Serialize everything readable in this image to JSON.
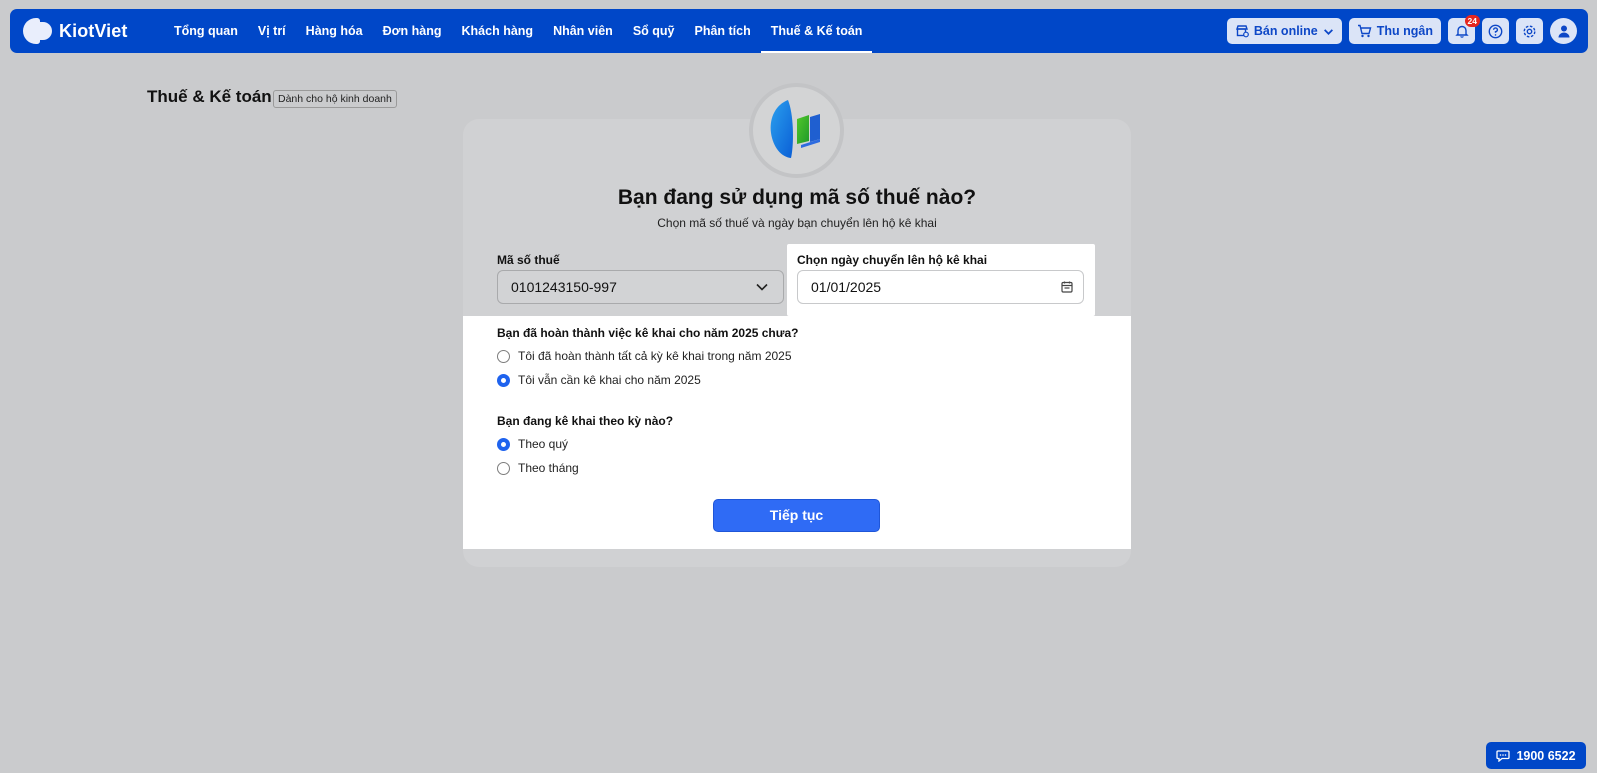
{
  "app": {
    "brand": "KiotViet"
  },
  "nav": {
    "items": [
      {
        "label": "Tổng quan"
      },
      {
        "label": "Vị trí"
      },
      {
        "label": "Hàng hóa"
      },
      {
        "label": "Đơn hàng"
      },
      {
        "label": "Khách hàng"
      },
      {
        "label": "Nhân viên"
      },
      {
        "label": "Sổ quỹ"
      },
      {
        "label": "Phân tích"
      },
      {
        "label": "Thuế & Kế toán"
      }
    ],
    "active": "Thuế & Kế toán",
    "sell_online_label": "Bán online",
    "cashier_label": "Thu ngân",
    "notification_count": "24"
  },
  "page": {
    "title": "Thuế & Kế toán",
    "tag": "Dành cho hộ kinh doanh"
  },
  "card": {
    "title": "Bạn đang sử dụng mã số thuế nào?",
    "subtitle": "Chọn mã số thuế và ngày bạn chuyển lên hộ kê khai",
    "tax_code_label": "Mã số thuế",
    "tax_code_value": "0101243150-997",
    "date_label": "Chọn ngày chuyển lên hộ kê khai",
    "date_value": "01/01/2025",
    "q1": {
      "question": "Bạn đã hoàn thành việc kê khai cho năm 2025 chưa?",
      "options": [
        {
          "label": "Tôi đã hoàn thành tất cả kỳ kê khai trong năm 2025",
          "selected": false
        },
        {
          "label": "Tôi vẫn cần kê khai cho năm 2025",
          "selected": true
        }
      ]
    },
    "q2": {
      "question": "Bạn đang kê khai theo kỳ nào?",
      "options": [
        {
          "label": "Theo quý",
          "selected": true
        },
        {
          "label": "Theo tháng",
          "selected": false
        }
      ]
    },
    "continue_label": "Tiếp tục"
  },
  "hotline": {
    "label": "1900 6522"
  },
  "colors": {
    "primary": "#0047c8",
    "accent": "#2f6bf5",
    "badge": "#e5261f"
  }
}
